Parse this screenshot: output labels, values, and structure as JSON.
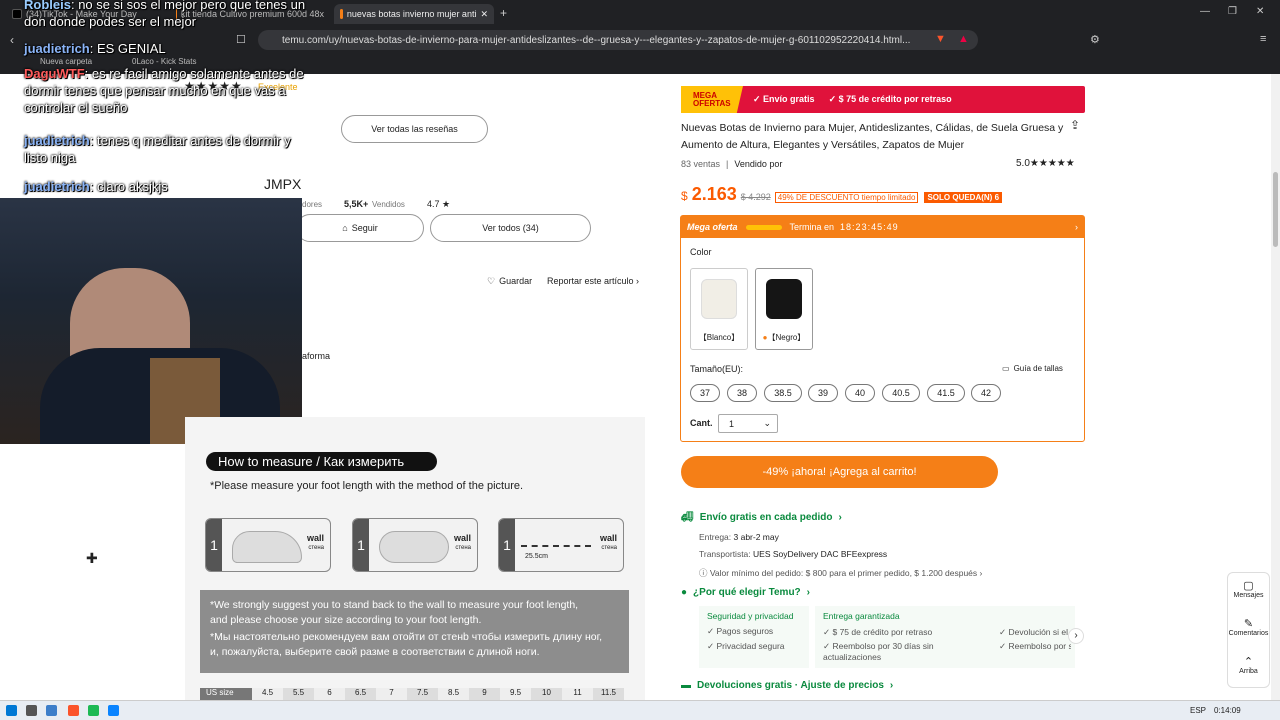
{
  "browser": {
    "tabs": [
      {
        "label": "(34)TikTok - Make Your Day",
        "icon": "tiktok-icon"
      },
      {
        "label": "kit tienda Cultivo premium 600d 48x",
        "icon": "temu-icon"
      },
      {
        "label": "nuevas botas invierno mujer anti",
        "icon": "temu-icon"
      }
    ],
    "url": "temu.com/uy/nuevas-botas-de-invierno-para-mujer-antideslizantes--de--gruesa-y---elegantes-y--zapatos-de-mujer-g-601102952220414.html...",
    "bookmarks": [
      "Nueva carpeta",
      "0Laco - Kick Stats"
    ]
  },
  "chat": [
    {
      "user": "Robleis",
      "msg": ": no se si sos el mejor pero que tenes un don donde podes ser el mejor"
    },
    {
      "user": "juadietrich",
      "msg": ": ES GENIAL"
    },
    {
      "user": "DaguWTF",
      "msg": ": es re facil amigo solamente antes de dormir tenes que pensar mucho en que vas a controlar el sueño"
    },
    {
      "user": "juadietrich",
      "msg": ": tenes q meditar antes de dormir y listo niga"
    },
    {
      "user": "juadietrich",
      "msg": ": claro aksjkjs"
    }
  ],
  "left": {
    "rating_text": "Excelente",
    "view_reviews": "Ver todas las reseñas",
    "store_name": "JMPX",
    "followers_label": "dores",
    "sold": "5,5K+",
    "sold_label": "Vendidos",
    "store_rating": "4.7 ★",
    "follow_btn": "Seguir",
    "view_all_btn": "Ver todos (34)",
    "save": "Guardar",
    "report": "Reportar este artículo",
    "partial_text": "aforma"
  },
  "measure": {
    "title": "How to measure / Как измерить",
    "subtitle": "*Please measure your foot length with the method of the picture.",
    "steps": [
      "1",
      "1",
      "1"
    ],
    "wall": "wall",
    "wall_ru": "стена",
    "scale": "25.5cm",
    "note_en_1": "*We strongly suggest you to stand back to the wall to measure your foot length,",
    "note_en_2": " and please choose your size according to your foot length.",
    "note_ru_1": "*Мы настоятельно рекомендуем вам отойти от стенb чтобы измерить длину ног,",
    "note_ru_2": "и, пожалуйста, выберите свой разме в соответствии с длиной ноги.",
    "us_row": [
      "US size",
      "4.5",
      "5.5",
      "6",
      "6.5",
      "7",
      "7.5",
      "8.5",
      "9",
      "9.5",
      "10",
      "11",
      "11.5"
    ]
  },
  "product": {
    "mega_1": "MEGA",
    "mega_2": "OFERTAS",
    "shipping_free": "✓ Envío gratis",
    "credit": "✓ $ 75 de crédito por retraso",
    "title": "Nuevas Botas de Invierno para Mujer, Antideslizantes, Cálidas, de Suela Gruesa y Aumento de Altura, Elegantes y Versátiles, Zapatos de Mujer",
    "sales": "83 ventas",
    "sold_by": "Vendido por",
    "rating": "5.0★★★★★",
    "currency": "$",
    "price": "2.163",
    "old_price": "$ 4.292",
    "discount": "49% DE DESCUENTO tiempo limitado",
    "stock": "SOLO QUEDA(N) 6",
    "offer_label": "Mega oferta",
    "ends_label": "Termina en",
    "countdown": "18:23:45:49",
    "color_label": "Color",
    "colors": [
      "【Blanco】",
      "【Negro】"
    ],
    "size_label": "Tamaño(EU):",
    "size_guide": "Guía de tallas",
    "sizes": [
      "37",
      "38",
      "38.5",
      "39",
      "40",
      "40.5",
      "41.5",
      "42"
    ],
    "qty_label": "Cant.",
    "qty": "1",
    "cart_btn": "-49% ¡ahora! ¡Agrega al carrito!",
    "free_ship_title": "Envío gratis en cada pedido",
    "delivery_label": "Entrega:",
    "delivery": "3 abr-2 may",
    "carrier_label": "Transportista:",
    "carriers": "UES  SoyDelivery  DAC  BFEexpress",
    "min_order": "Valor mínimo del pedido: $ 800 para el primer pedido, $ 1.200 después",
    "why_temu": "¿Por qué elegir Temu?",
    "sec_title": "Seguridad y privacidad",
    "sec_1": "✓ Pagos seguros",
    "sec_2": "✓ Privacidad segura",
    "del_title": "Entrega garantizada",
    "del_1": "✓ $ 75 de crédito por retraso",
    "del_2": "✓ Reembolso por 30 días sin actualizaciones",
    "del_3": "✓ Devolución si el",
    "del_4": "✓ Reembolso por s",
    "returns": "Devoluciones gratis · Ajuste de precios"
  },
  "side": {
    "messages": "Mensajes",
    "comments": "Comentarios",
    "top": "Arriba"
  },
  "taskbar": {
    "lang": "ESP",
    "time": "0:14:09"
  }
}
